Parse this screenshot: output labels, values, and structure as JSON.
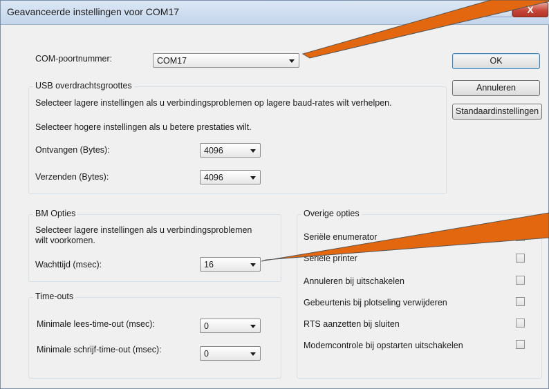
{
  "window": {
    "title": "Geavanceerde instellingen voor COM17",
    "help_glyph": "?",
    "close_glyph": "X"
  },
  "com_port": {
    "label": "COM-poortnummer:",
    "value": "COM17"
  },
  "buttons": {
    "ok": "OK",
    "cancel": "Annuleren",
    "defaults": "Standaardinstellingen"
  },
  "usb": {
    "title": "USB overdrachtsgroottes",
    "desc1": "Selecteer lagere instellingen als u verbindingsproblemen op lagere baud-rates wilt verhelpen.",
    "desc2": "Selecteer hogere instellingen als u betere prestaties wilt.",
    "receive_label": "Ontvangen (Bytes):",
    "receive_value": "4096",
    "send_label": "Verzenden (Bytes):",
    "send_value": "4096"
  },
  "bm": {
    "title": "BM Opties",
    "desc": "Selecteer lagere instellingen als u verbindingsproblemen\nwilt voorkomen.",
    "latency_label": "Wachttijd (msec):",
    "latency_value": "16"
  },
  "timeouts": {
    "title": "Time-outs",
    "read_label": "Minimale lees-time-out (msec):",
    "read_value": "0",
    "write_label": "Minimale schrijf-time-out (msec):",
    "write_value": "0"
  },
  "misc": {
    "title": "Overige opties",
    "options": [
      {
        "label": "Seriële enumerator",
        "checked": true
      },
      {
        "label": "Seriële printer",
        "checked": false
      },
      {
        "label": "Annuleren bij uitschakelen",
        "checked": false
      },
      {
        "label": "Gebeurtenis bij plotseling verwijderen",
        "checked": false
      },
      {
        "label": "RTS aanzetten bij sluiten",
        "checked": false
      },
      {
        "label": "Modemcontrole bij opstarten uitschakelen",
        "checked": false
      }
    ]
  },
  "annotation_color": "#e2670e"
}
